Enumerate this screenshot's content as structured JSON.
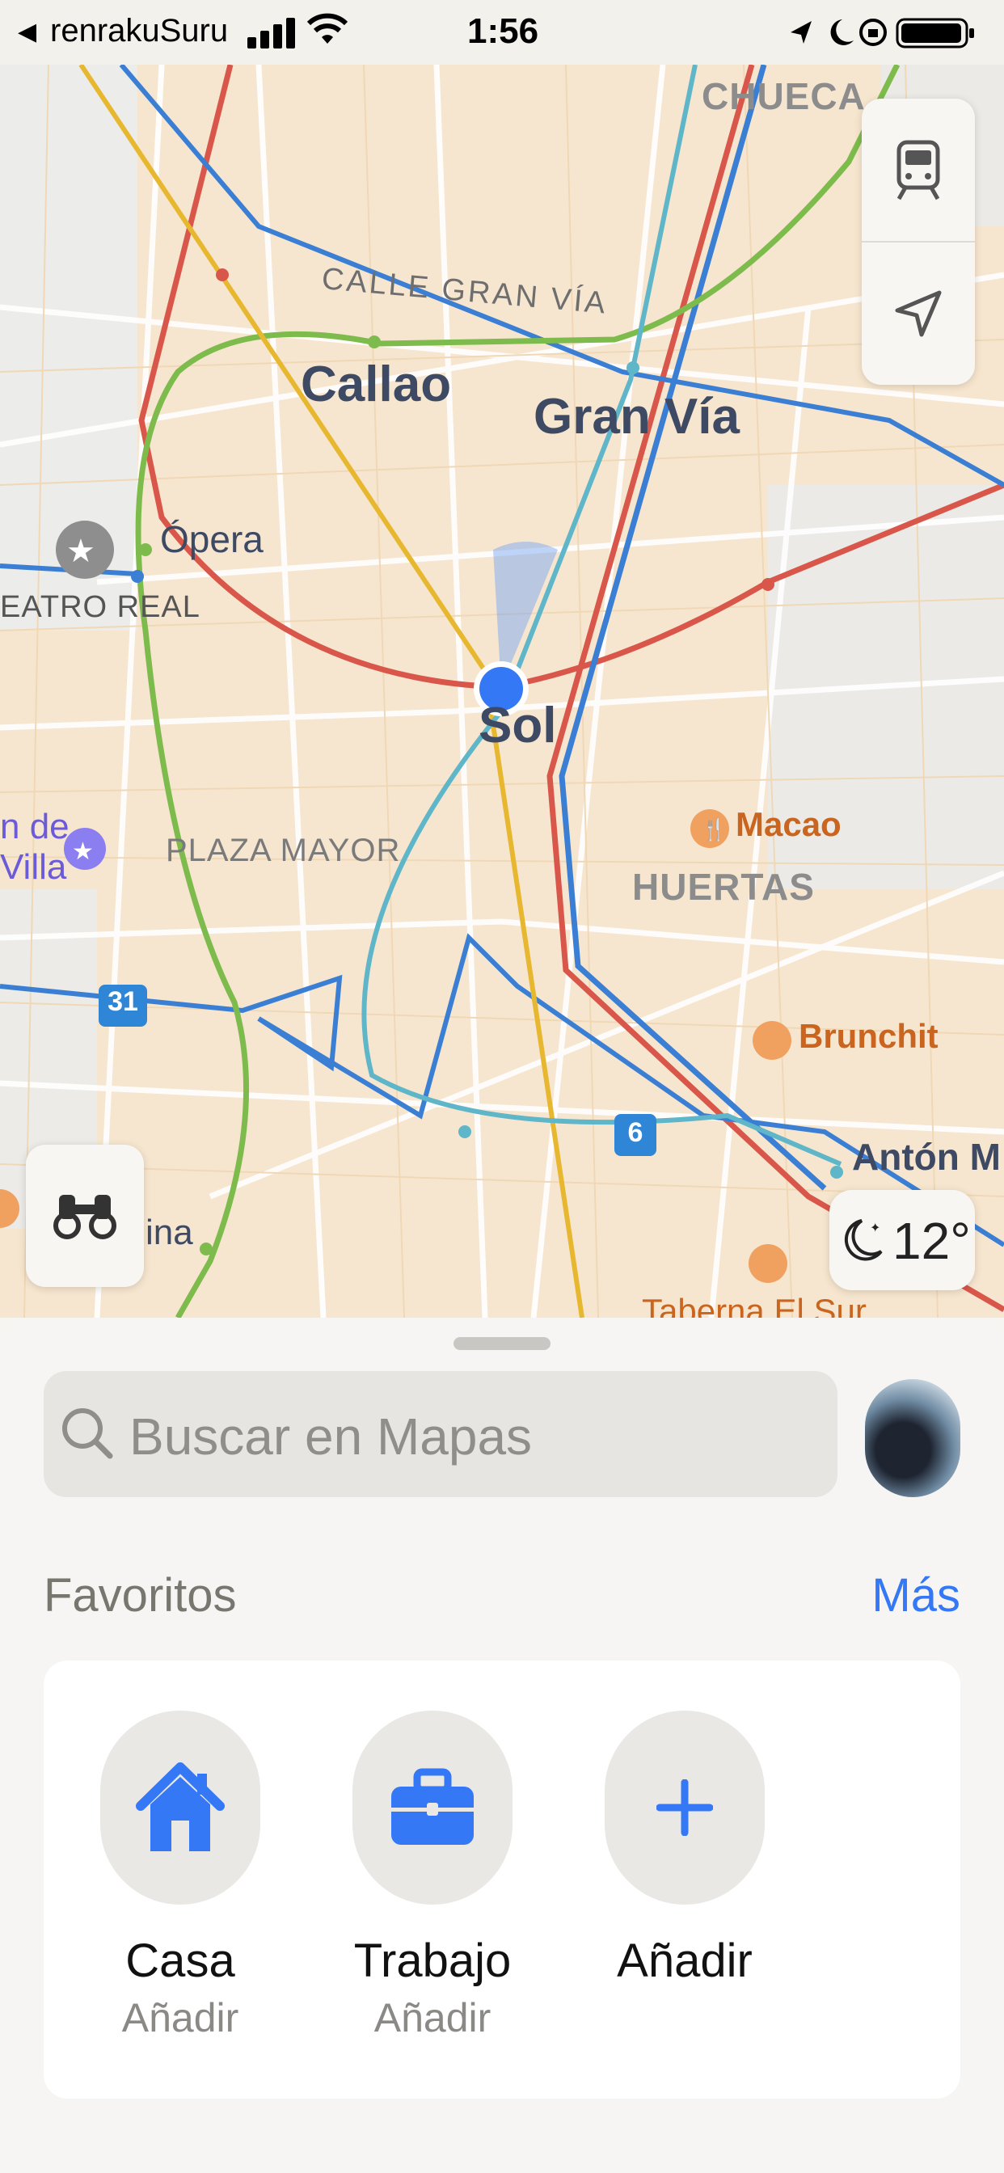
{
  "status": {
    "back_app": "renrakuSuru",
    "time": "1:56"
  },
  "map": {
    "districts": {
      "chueca": "CHUECA",
      "huertas": "HUERTAS",
      "plaza_mayor": "PLAZA MAYOR"
    },
    "streets": {
      "gran_via": "CALLE GRAN VÍA"
    },
    "stations": {
      "callao": "Callao",
      "gran_via": "Gran Vía",
      "sol": "Sol",
      "opera": "Ópera",
      "anton": "Antón M"
    },
    "places": {
      "teatro_real": "EATRO REAL",
      "villa_1": "n de",
      "villa_2": "Villa",
      "ina": "ina"
    },
    "pois": {
      "macao": "Macao",
      "brunchit": "Brunchit",
      "taberna": "Taberna El Sur"
    },
    "route_badges": {
      "r31": "31",
      "r6": "6"
    },
    "weather": {
      "temp": "12°",
      "icon": "moon-stars-icon"
    },
    "colors": {
      "line_red": "#d9564a",
      "line_blue": "#3b7fd4",
      "line_green": "#7dbb4c",
      "line_yellow": "#e8b730",
      "line_teal": "#5fb6c9",
      "user_dot": "#3478f6"
    }
  },
  "sheet": {
    "search_placeholder": "Buscar en Mapas",
    "favorites_title": "Favoritos",
    "favorites_more": "Más",
    "favorites": [
      {
        "name": "Casa",
        "sub": "Añadir",
        "icon": "house-icon"
      },
      {
        "name": "Trabajo",
        "sub": "Añadir",
        "icon": "briefcase-icon"
      },
      {
        "name": "Añadir",
        "sub": "",
        "icon": "plus-icon"
      }
    ],
    "accent": "#3478f6"
  }
}
